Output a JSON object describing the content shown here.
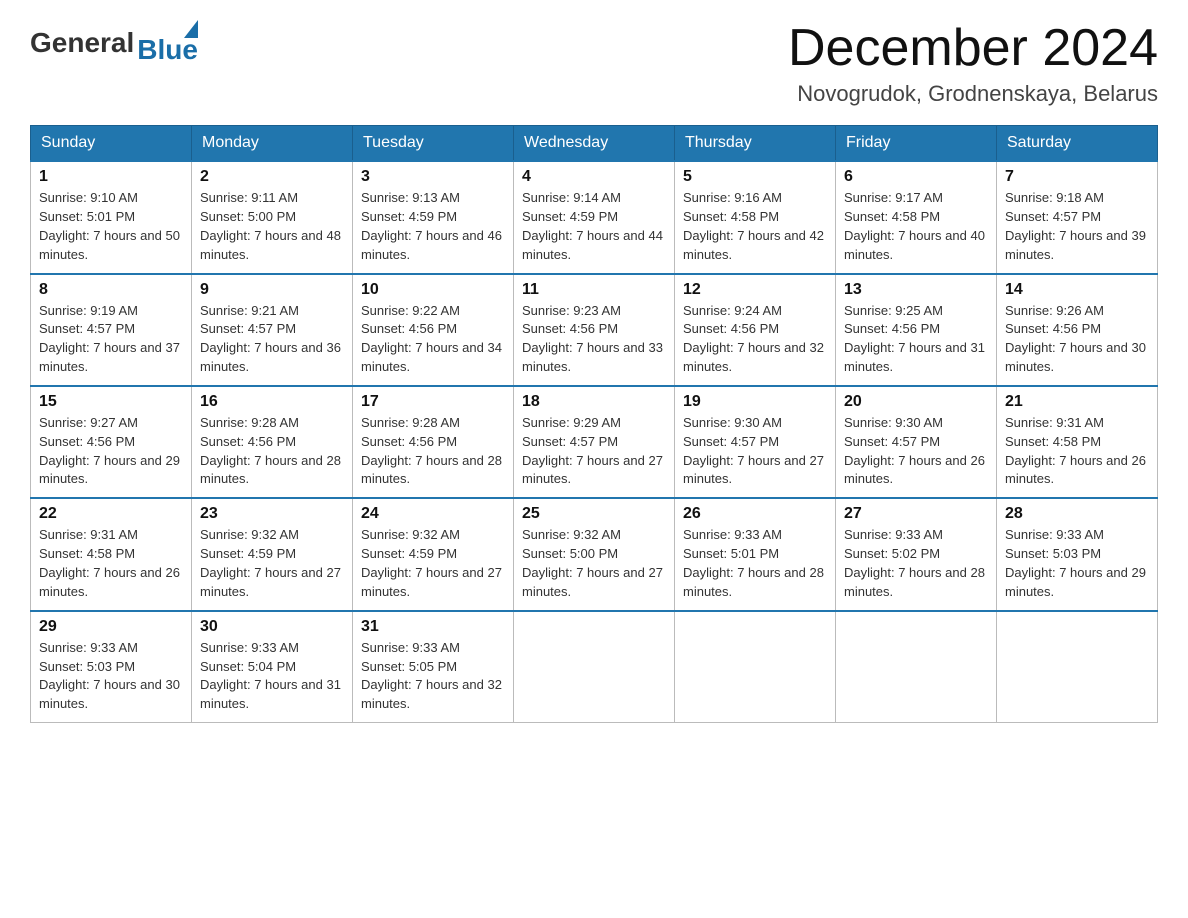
{
  "header": {
    "logo": {
      "general": "General",
      "blue": "Blue"
    },
    "title": "December 2024",
    "location": "Novogrudok, Grodnenskaya, Belarus"
  },
  "calendar": {
    "days_of_week": [
      "Sunday",
      "Monday",
      "Tuesday",
      "Wednesday",
      "Thursday",
      "Friday",
      "Saturday"
    ],
    "weeks": [
      [
        {
          "date": "1",
          "sunrise": "9:10 AM",
          "sunset": "5:01 PM",
          "daylight": "7 hours and 50 minutes."
        },
        {
          "date": "2",
          "sunrise": "9:11 AM",
          "sunset": "5:00 PM",
          "daylight": "7 hours and 48 minutes."
        },
        {
          "date": "3",
          "sunrise": "9:13 AM",
          "sunset": "4:59 PM",
          "daylight": "7 hours and 46 minutes."
        },
        {
          "date": "4",
          "sunrise": "9:14 AM",
          "sunset": "4:59 PM",
          "daylight": "7 hours and 44 minutes."
        },
        {
          "date": "5",
          "sunrise": "9:16 AM",
          "sunset": "4:58 PM",
          "daylight": "7 hours and 42 minutes."
        },
        {
          "date": "6",
          "sunrise": "9:17 AM",
          "sunset": "4:58 PM",
          "daylight": "7 hours and 40 minutes."
        },
        {
          "date": "7",
          "sunrise": "9:18 AM",
          "sunset": "4:57 PM",
          "daylight": "7 hours and 39 minutes."
        }
      ],
      [
        {
          "date": "8",
          "sunrise": "9:19 AM",
          "sunset": "4:57 PM",
          "daylight": "7 hours and 37 minutes."
        },
        {
          "date": "9",
          "sunrise": "9:21 AM",
          "sunset": "4:57 PM",
          "daylight": "7 hours and 36 minutes."
        },
        {
          "date": "10",
          "sunrise": "9:22 AM",
          "sunset": "4:56 PM",
          "daylight": "7 hours and 34 minutes."
        },
        {
          "date": "11",
          "sunrise": "9:23 AM",
          "sunset": "4:56 PM",
          "daylight": "7 hours and 33 minutes."
        },
        {
          "date": "12",
          "sunrise": "9:24 AM",
          "sunset": "4:56 PM",
          "daylight": "7 hours and 32 minutes."
        },
        {
          "date": "13",
          "sunrise": "9:25 AM",
          "sunset": "4:56 PM",
          "daylight": "7 hours and 31 minutes."
        },
        {
          "date": "14",
          "sunrise": "9:26 AM",
          "sunset": "4:56 PM",
          "daylight": "7 hours and 30 minutes."
        }
      ],
      [
        {
          "date": "15",
          "sunrise": "9:27 AM",
          "sunset": "4:56 PM",
          "daylight": "7 hours and 29 minutes."
        },
        {
          "date": "16",
          "sunrise": "9:28 AM",
          "sunset": "4:56 PM",
          "daylight": "7 hours and 28 minutes."
        },
        {
          "date": "17",
          "sunrise": "9:28 AM",
          "sunset": "4:56 PM",
          "daylight": "7 hours and 28 minutes."
        },
        {
          "date": "18",
          "sunrise": "9:29 AM",
          "sunset": "4:57 PM",
          "daylight": "7 hours and 27 minutes."
        },
        {
          "date": "19",
          "sunrise": "9:30 AM",
          "sunset": "4:57 PM",
          "daylight": "7 hours and 27 minutes."
        },
        {
          "date": "20",
          "sunrise": "9:30 AM",
          "sunset": "4:57 PM",
          "daylight": "7 hours and 26 minutes."
        },
        {
          "date": "21",
          "sunrise": "9:31 AM",
          "sunset": "4:58 PM",
          "daylight": "7 hours and 26 minutes."
        }
      ],
      [
        {
          "date": "22",
          "sunrise": "9:31 AM",
          "sunset": "4:58 PM",
          "daylight": "7 hours and 26 minutes."
        },
        {
          "date": "23",
          "sunrise": "9:32 AM",
          "sunset": "4:59 PM",
          "daylight": "7 hours and 27 minutes."
        },
        {
          "date": "24",
          "sunrise": "9:32 AM",
          "sunset": "4:59 PM",
          "daylight": "7 hours and 27 minutes."
        },
        {
          "date": "25",
          "sunrise": "9:32 AM",
          "sunset": "5:00 PM",
          "daylight": "7 hours and 27 minutes."
        },
        {
          "date": "26",
          "sunrise": "9:33 AM",
          "sunset": "5:01 PM",
          "daylight": "7 hours and 28 minutes."
        },
        {
          "date": "27",
          "sunrise": "9:33 AM",
          "sunset": "5:02 PM",
          "daylight": "7 hours and 28 minutes."
        },
        {
          "date": "28",
          "sunrise": "9:33 AM",
          "sunset": "5:03 PM",
          "daylight": "7 hours and 29 minutes."
        }
      ],
      [
        {
          "date": "29",
          "sunrise": "9:33 AM",
          "sunset": "5:03 PM",
          "daylight": "7 hours and 30 minutes."
        },
        {
          "date": "30",
          "sunrise": "9:33 AM",
          "sunset": "5:04 PM",
          "daylight": "7 hours and 31 minutes."
        },
        {
          "date": "31",
          "sunrise": "9:33 AM",
          "sunset": "5:05 PM",
          "daylight": "7 hours and 32 minutes."
        },
        null,
        null,
        null,
        null
      ]
    ]
  }
}
